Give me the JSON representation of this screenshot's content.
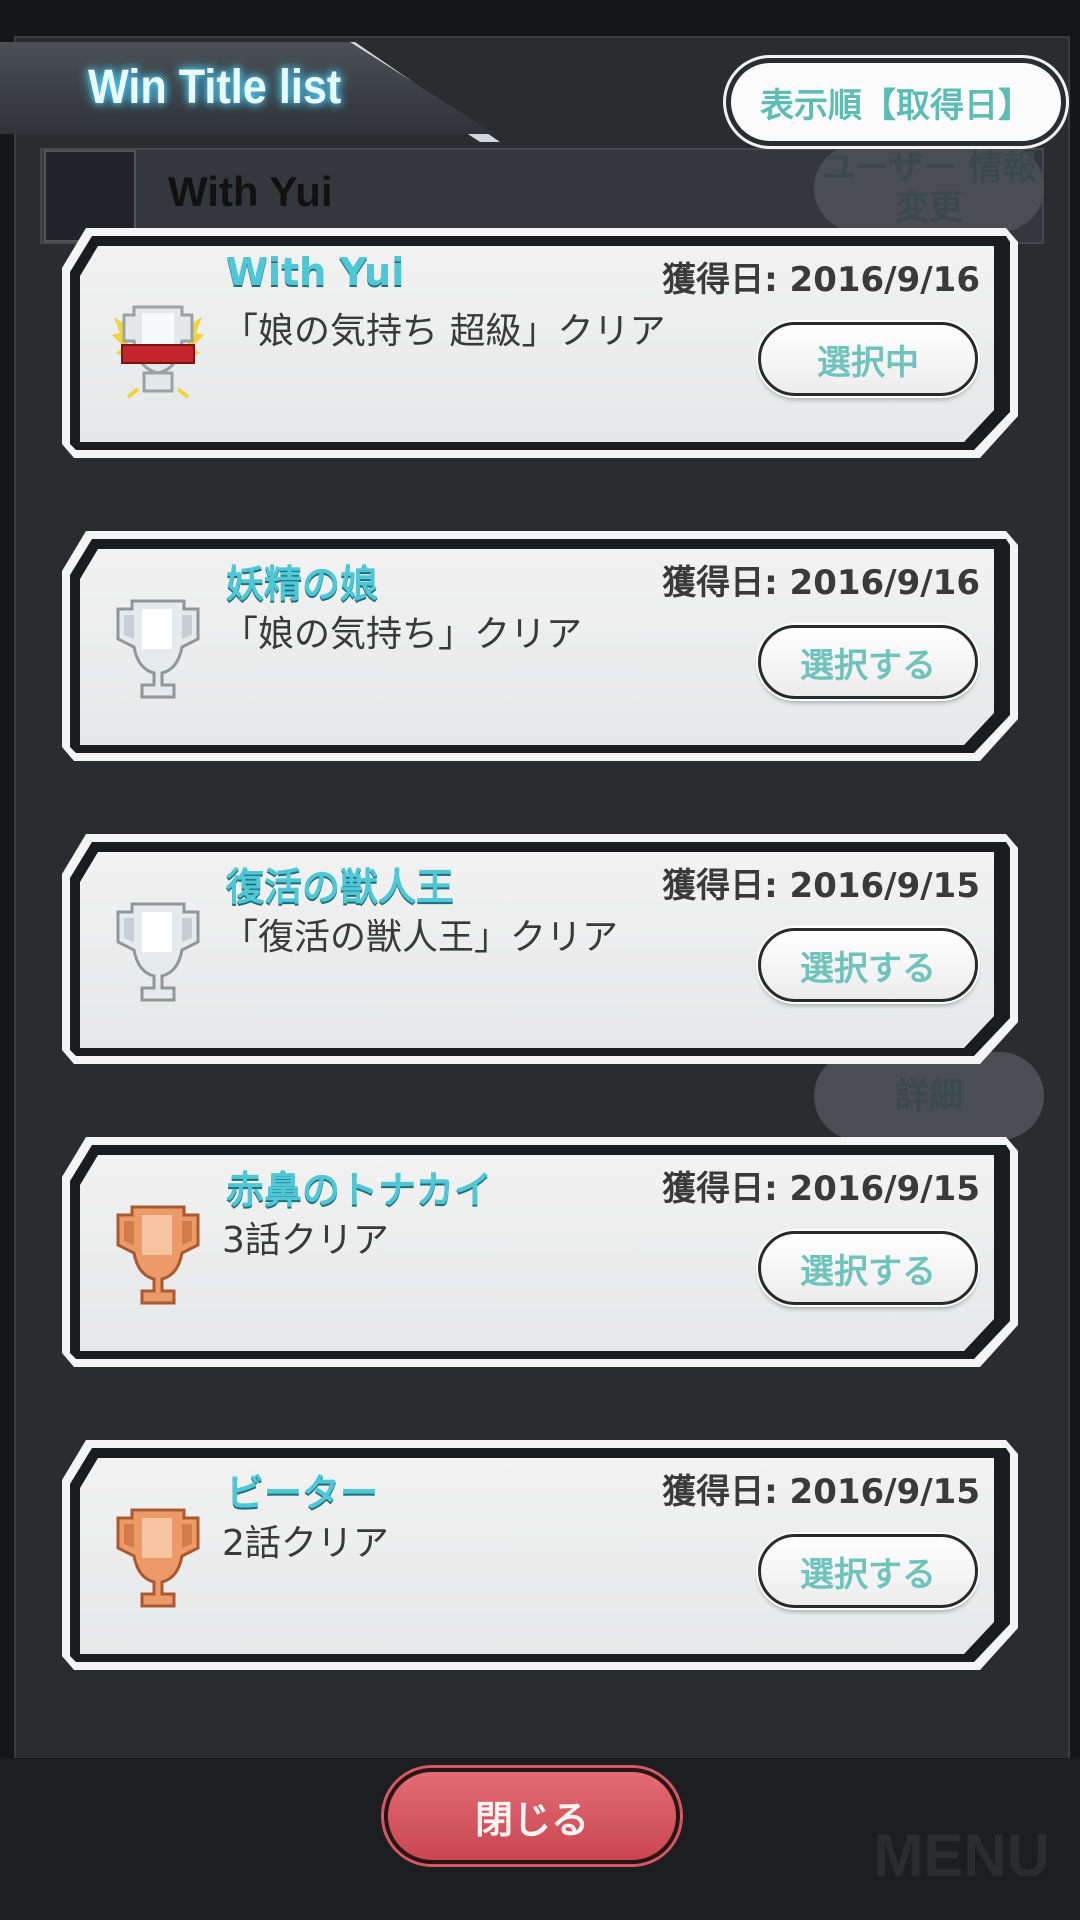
{
  "header": {
    "title": "Win Title list",
    "sort_label": "表示順【取得日】"
  },
  "background": {
    "player_name": "With Yui",
    "user_info_button": "ユーザー 情報変更",
    "detail_button": "詳細",
    "menu_label": "MENU"
  },
  "titles": [
    {
      "name": "With Yui",
      "desc": "「娘の気持ち 超級」クリア",
      "date": "獲得日: 2016/9/16",
      "button": "選択中",
      "trophy": "gold-ribbon-trophy-icon"
    },
    {
      "name": "妖精の娘",
      "desc": "「娘の気持ち」クリア",
      "date": "獲得日: 2016/9/16",
      "button": "選択する",
      "trophy": "silver-trophy-icon"
    },
    {
      "name": "復活の獣人王",
      "desc": "「復活の獣人王」クリア",
      "date": "獲得日: 2016/9/15",
      "button": "選択する",
      "trophy": "silver-trophy-icon"
    },
    {
      "name": "赤鼻のトナカイ",
      "desc": "3話クリア",
      "date": "獲得日: 2016/9/15",
      "button": "選択する",
      "trophy": "bronze-trophy-icon"
    },
    {
      "name": "ビーター",
      "desc": "2話クリア",
      "date": "獲得日: 2016/9/15",
      "button": "選択する",
      "trophy": "bronze-trophy-icon"
    }
  ],
  "footer": {
    "close_label": "閉じる"
  },
  "colors": {
    "accent_cyan": "#4fc7d6",
    "button_text": "#70c2bc",
    "close_red": "#d35a62",
    "silver": "#d8dcde",
    "bronze": "#e6905e",
    "gold": "#f0d23a"
  }
}
